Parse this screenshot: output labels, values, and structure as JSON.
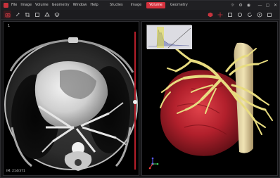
{
  "menu": [
    "File",
    "Image",
    "Volume",
    "Geometry",
    "Window",
    "Help"
  ],
  "mode_tabs": [
    {
      "label": "Studies",
      "active": false
    },
    {
      "label": "Image",
      "active": false
    },
    {
      "label": "Volume",
      "active": true
    },
    {
      "label": "Geometry",
      "active": false
    }
  ],
  "left_view": {
    "slice_index": "1",
    "slice_info": "IM: 214/371"
  },
  "colors": {
    "accent": "#d5313d",
    "background": "#000000",
    "toolbar": "#1c1c1f"
  },
  "window_controls": {
    "minimize": "—",
    "maximize": "▢",
    "close": "✕"
  }
}
